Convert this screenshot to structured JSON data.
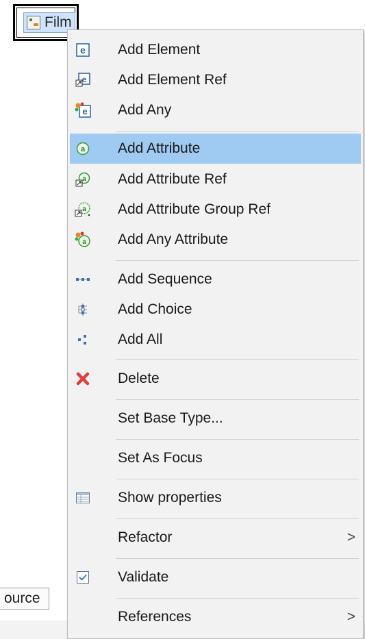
{
  "tree": {
    "node_label": "Film",
    "node_icon": "complex-type-icon"
  },
  "editor": {
    "source_tab_label": "ource"
  },
  "menu": {
    "items": [
      {
        "label": "Add Element",
        "icon": "element-icon"
      },
      {
        "label": "Add Element Ref",
        "icon": "element-ref-icon"
      },
      {
        "label": "Add Any",
        "icon": "any-element-icon"
      },
      {
        "label": "Add Attribute",
        "icon": "attribute-icon",
        "highlighted": true
      },
      {
        "label": "Add Attribute Ref",
        "icon": "attribute-ref-icon"
      },
      {
        "label": "Add Attribute Group Ref",
        "icon": "attribute-group-ref-icon"
      },
      {
        "label": "Add Any Attribute",
        "icon": "any-attribute-icon"
      },
      {
        "label": "Add Sequence",
        "icon": "sequence-icon"
      },
      {
        "label": "Add Choice",
        "icon": "choice-icon"
      },
      {
        "label": "Add All",
        "icon": "all-icon"
      },
      {
        "label": "Delete",
        "icon": "delete-icon"
      },
      {
        "label": "Set Base Type..."
      },
      {
        "label": "Set As Focus"
      },
      {
        "label": "Show properties",
        "icon": "properties-icon"
      },
      {
        "label": "Refactor",
        "has_submenu": true,
        "submenu_glyph": ">"
      },
      {
        "label": "Validate",
        "icon": "validate-checkbox-icon"
      },
      {
        "label": "References",
        "has_submenu": true,
        "submenu_glyph": ">"
      }
    ]
  },
  "colors": {
    "menu_background": "#f2f2f2",
    "highlight": "#9fcaf1",
    "separator": "#cfcfcf",
    "delete_red": "#e33b3b",
    "icon_blue": "#2b5fa8"
  }
}
